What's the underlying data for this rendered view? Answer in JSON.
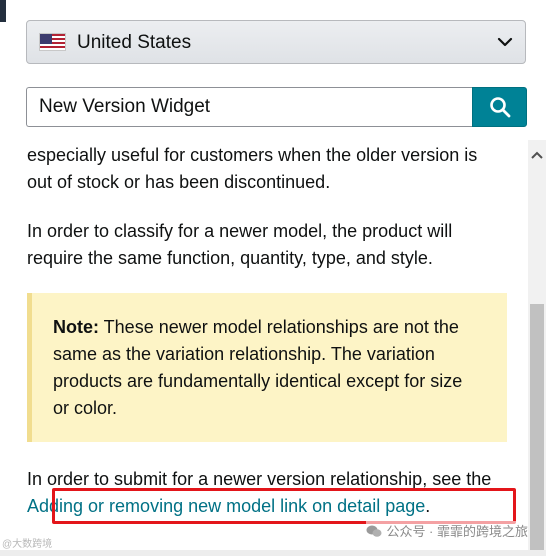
{
  "country_selector": {
    "selected": "United States",
    "flag_icon": "us-flag-icon"
  },
  "search": {
    "value": "New Version Widget"
  },
  "content": {
    "intro_text": "especially useful for customers when the older version is out of stock or has been discontinued.",
    "classify_text": "In order to classify for a newer model, the product will require the same function, quantity, type, and style.",
    "note": {
      "label": "Note:",
      "text": " These newer model relationships are not the same as the variation relationship. The variation products are fundamentally identical except for size or color."
    },
    "submit_text": "In order to submit for a newer version relationship, see the ",
    "link_text": "Adding or removing new model link on detail page",
    "submit_end": "."
  },
  "watermark": {
    "right": "公众号 · 霏霏的跨境之旅",
    "left": "@大数跨境"
  },
  "colors": {
    "accent": "#008296",
    "link": "#007185",
    "note_bg": "#fdf4c6",
    "highlight": "#e3151a"
  }
}
